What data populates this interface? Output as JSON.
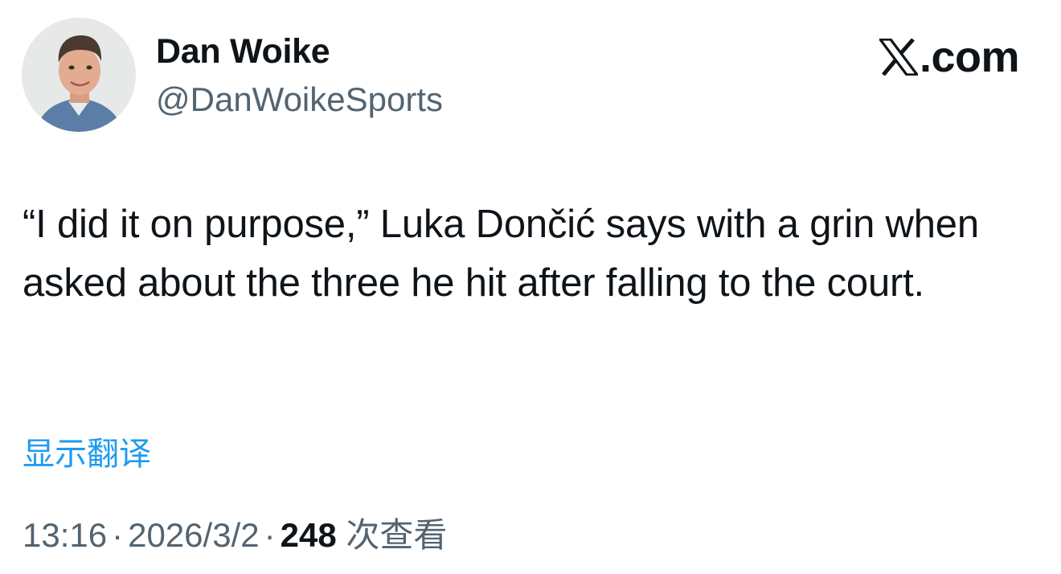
{
  "author": {
    "display_name": "Dan Woike",
    "handle": "@DanWoikeSports"
  },
  "brand": {
    "text": ".com",
    "icon": "x-logo-icon"
  },
  "tweet": {
    "text": "“I did it on purpose,” Luka Dončić says with a grin when asked about the three he hit after falling to the court."
  },
  "translate": {
    "label": "显示翻译"
  },
  "meta": {
    "time": "13:16",
    "separator": "·",
    "date": "2026/3/2",
    "views_count": "248",
    "views_label": "次查看"
  },
  "colors": {
    "text_primary": "#0f1419",
    "text_secondary": "#536471",
    "link": "#1d9bf0"
  }
}
